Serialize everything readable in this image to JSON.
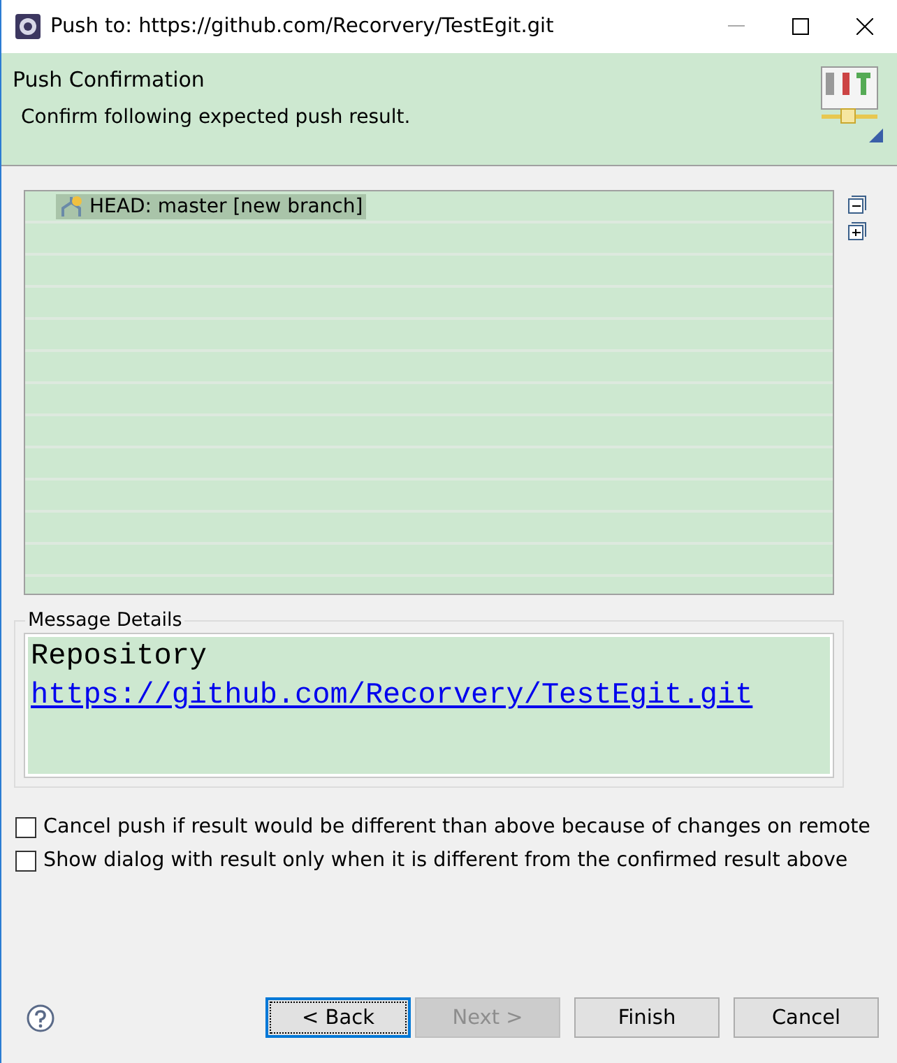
{
  "window": {
    "title": "Push to: https://github.com/Recorvery/TestEgit.git"
  },
  "header": {
    "title": "Push Confirmation",
    "description": "Confirm following expected push result."
  },
  "tree": {
    "items": [
      {
        "label": "HEAD: master [new branch]",
        "selected": true
      }
    ]
  },
  "message_details": {
    "label": "Message Details",
    "heading": "Repository",
    "link": "https://github.com/Recorvery/TestEgit.git"
  },
  "options": [
    {
      "label": "Cancel push if result would be different than above because of changes on remote",
      "checked": false
    },
    {
      "label": "Show dialog with result only when it is different from the confirmed result above",
      "checked": false
    }
  ],
  "buttons": [
    {
      "label": "< Back",
      "disabled": false,
      "focused": true
    },
    {
      "label": "Next >",
      "disabled": true,
      "focused": false
    },
    {
      "label": "Finish",
      "disabled": false,
      "focused": false
    },
    {
      "label": "Cancel",
      "disabled": false,
      "focused": false
    }
  ]
}
